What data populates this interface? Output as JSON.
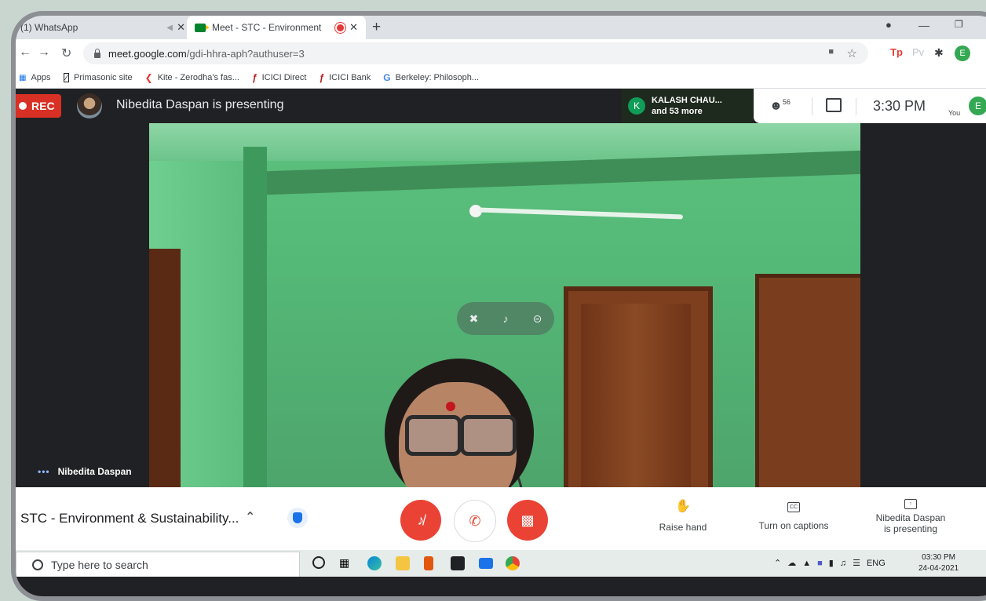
{
  "browser": {
    "tabs": [
      {
        "label": "(1) WhatsApp",
        "active": false
      },
      {
        "label": "Meet - STC - Environment &",
        "active": true,
        "recording": true
      }
    ],
    "new_tab_label": "+",
    "url_domain": "meet.google.com",
    "url_path": "/gdi-hhra-aph?authuser=3",
    "profile_initial": "E",
    "extensions": [
      "Tp",
      "Pv"
    ]
  },
  "bookmarks": [
    {
      "label": "Apps",
      "icon": "apps-grid-icon",
      "color": "#1a73e8"
    },
    {
      "label": "Primasonic site",
      "icon": "primasonic-icon",
      "color": "#202124"
    },
    {
      "label": "Kite - Zerodha's fas...",
      "icon": "kite-icon",
      "color": "#e53935"
    },
    {
      "label": "ICICI Direct",
      "icon": "icici-icon",
      "color": "#b71c1c"
    },
    {
      "label": "ICICI Bank",
      "icon": "icici-icon",
      "color": "#b71c1c"
    },
    {
      "label": "Berkeley: Philosoph...",
      "icon": "google-g-icon",
      "color": "#4285f4"
    }
  ],
  "meet_top": {
    "rec_label": "REC",
    "presenting_text": "Nibedita Daspan is presenting",
    "speaker_initial": "K",
    "speaker_name": "KALASH CHAU...",
    "speaker_more": "and 53 more",
    "participant_count": "56",
    "time": "3:30 PM",
    "you_label": "You",
    "you_initial": "E"
  },
  "video": {
    "tile_name": "Nibedita Daspan",
    "tile_dots": "•••"
  },
  "controls": {
    "meeting_title": "STC - Environment & Sustainability...",
    "raise_hand": "Raise hand",
    "captions": "Turn on captions",
    "presenting_line1": "Nibedita Daspan",
    "presenting_line2": "is presenting",
    "captions_icon_text": "CC"
  },
  "taskbar": {
    "search_placeholder": "Type here to search",
    "tray_lang": "ENG",
    "clock_time": "03:30 PM",
    "clock_date": "24-04-2021"
  },
  "colors": {
    "meet_red": "#ea4335",
    "rec_red": "#d93025",
    "accent_blue": "#1a73e8",
    "avatar_green": "#34a853"
  }
}
